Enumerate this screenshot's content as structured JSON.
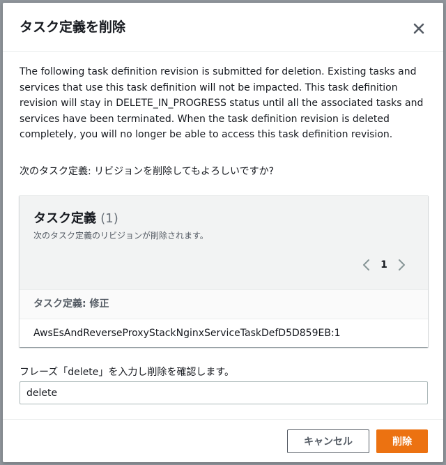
{
  "colors": {
    "primary_button": "#ec7211",
    "text": "#16191f",
    "muted_text": "#545b64",
    "panel_header_bg": "#f2f3f3"
  },
  "modal": {
    "title": "タスク定義を削除",
    "close_icon": "close-icon",
    "description": "The following task definition revision is submitted for deletion. Existing tasks and services that use this task definition will not be impacted. This task definition revision will stay in DELETE_IN_PROGRESS status until all the associated tasks and services have been terminated. When the task definition revision is deleted completely, you will no longer be able to access this task definition revision.",
    "confirm_question": "次のタスク定義: リビジョンを削除してもよろしいですか?"
  },
  "panel": {
    "title": "タスク定義",
    "count": "(1)",
    "subtitle": "次のタスク定義のリビジョンが削除されます。",
    "pagination": {
      "current_page": "1",
      "prev_icon": "chevron-left-icon",
      "next_icon": "chevron-right-icon"
    },
    "column_header": "タスク定義: 修正",
    "rows": [
      "AwsEsAndReverseProxyStackNginxServiceTaskDefD5D859EB:1"
    ]
  },
  "confirmation": {
    "label": "フレーズ「delete」を入力し削除を確認します。",
    "input_value": "delete"
  },
  "footer": {
    "cancel_label": "キャンセル",
    "delete_label": "削除"
  }
}
